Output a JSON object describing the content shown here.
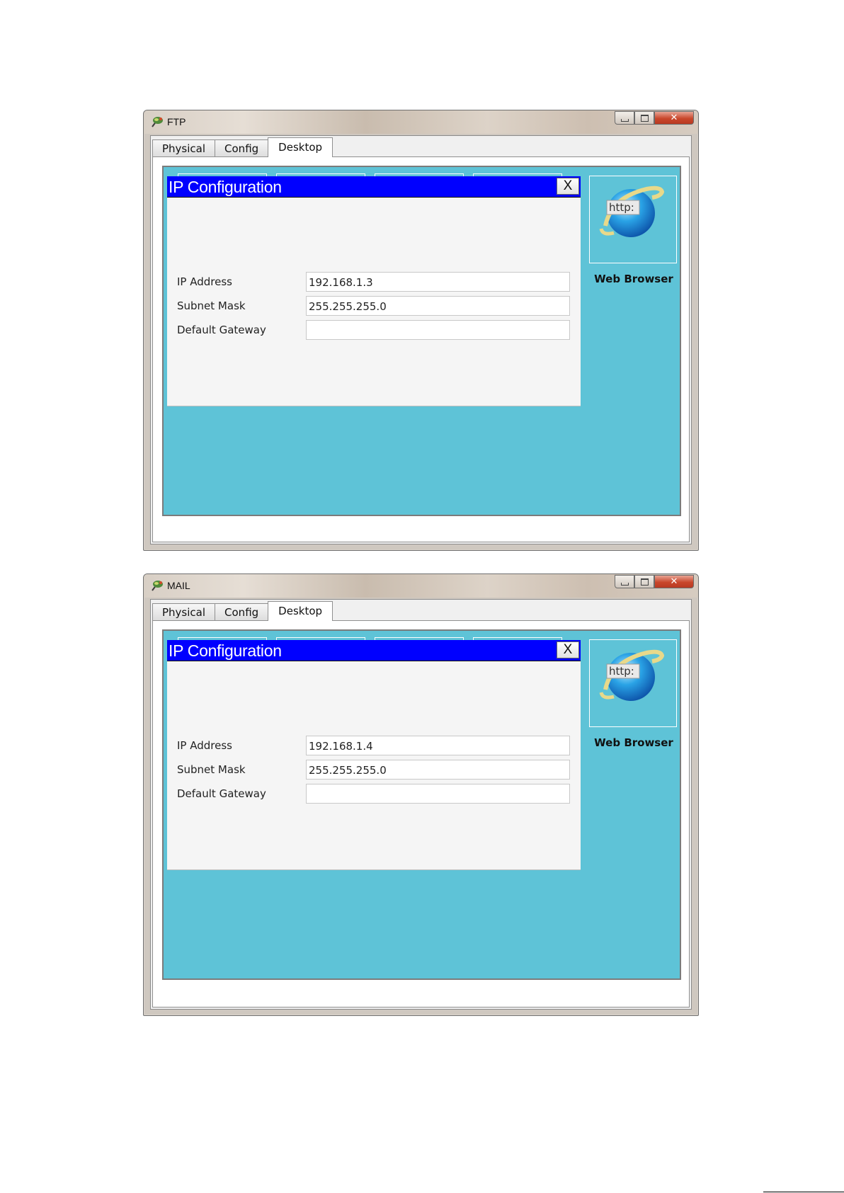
{
  "windows": [
    {
      "title": "FTP",
      "tabs": [
        "Physical",
        "Config",
        "Desktop"
      ],
      "active_tab": "Desktop",
      "dialog": {
        "title": "IP Configuration",
        "close_label": "X",
        "fields": [
          {
            "label": "IP Address",
            "value": "192.168.1.3"
          },
          {
            "label": "Subnet Mask",
            "value": "255.255.255.0"
          },
          {
            "label": "Default Gateway",
            "value": ""
          }
        ]
      },
      "web_browser": {
        "icon_text": "http:",
        "label": "Web Browser"
      }
    },
    {
      "title": "MAIL",
      "tabs": [
        "Physical",
        "Config",
        "Desktop"
      ],
      "active_tab": "Desktop",
      "dialog": {
        "title": "IP Configuration",
        "close_label": "X",
        "fields": [
          {
            "label": "IP Address",
            "value": "192.168.1.4"
          },
          {
            "label": "Subnet Mask",
            "value": "255.255.255.0"
          },
          {
            "label": "Default Gateway",
            "value": ""
          }
        ]
      },
      "web_browser": {
        "icon_text": "http:",
        "label": "Web Browser"
      }
    }
  ],
  "colors": {
    "desktop_bg": "#5ec3d7",
    "dialog_title_bg": "#0000ff",
    "close_button": "#c9472c"
  },
  "icons": [
    "packet-tracer-app-icon",
    "minimize-icon",
    "maximize-icon",
    "close-icon",
    "web-browser-globe-icon"
  ]
}
